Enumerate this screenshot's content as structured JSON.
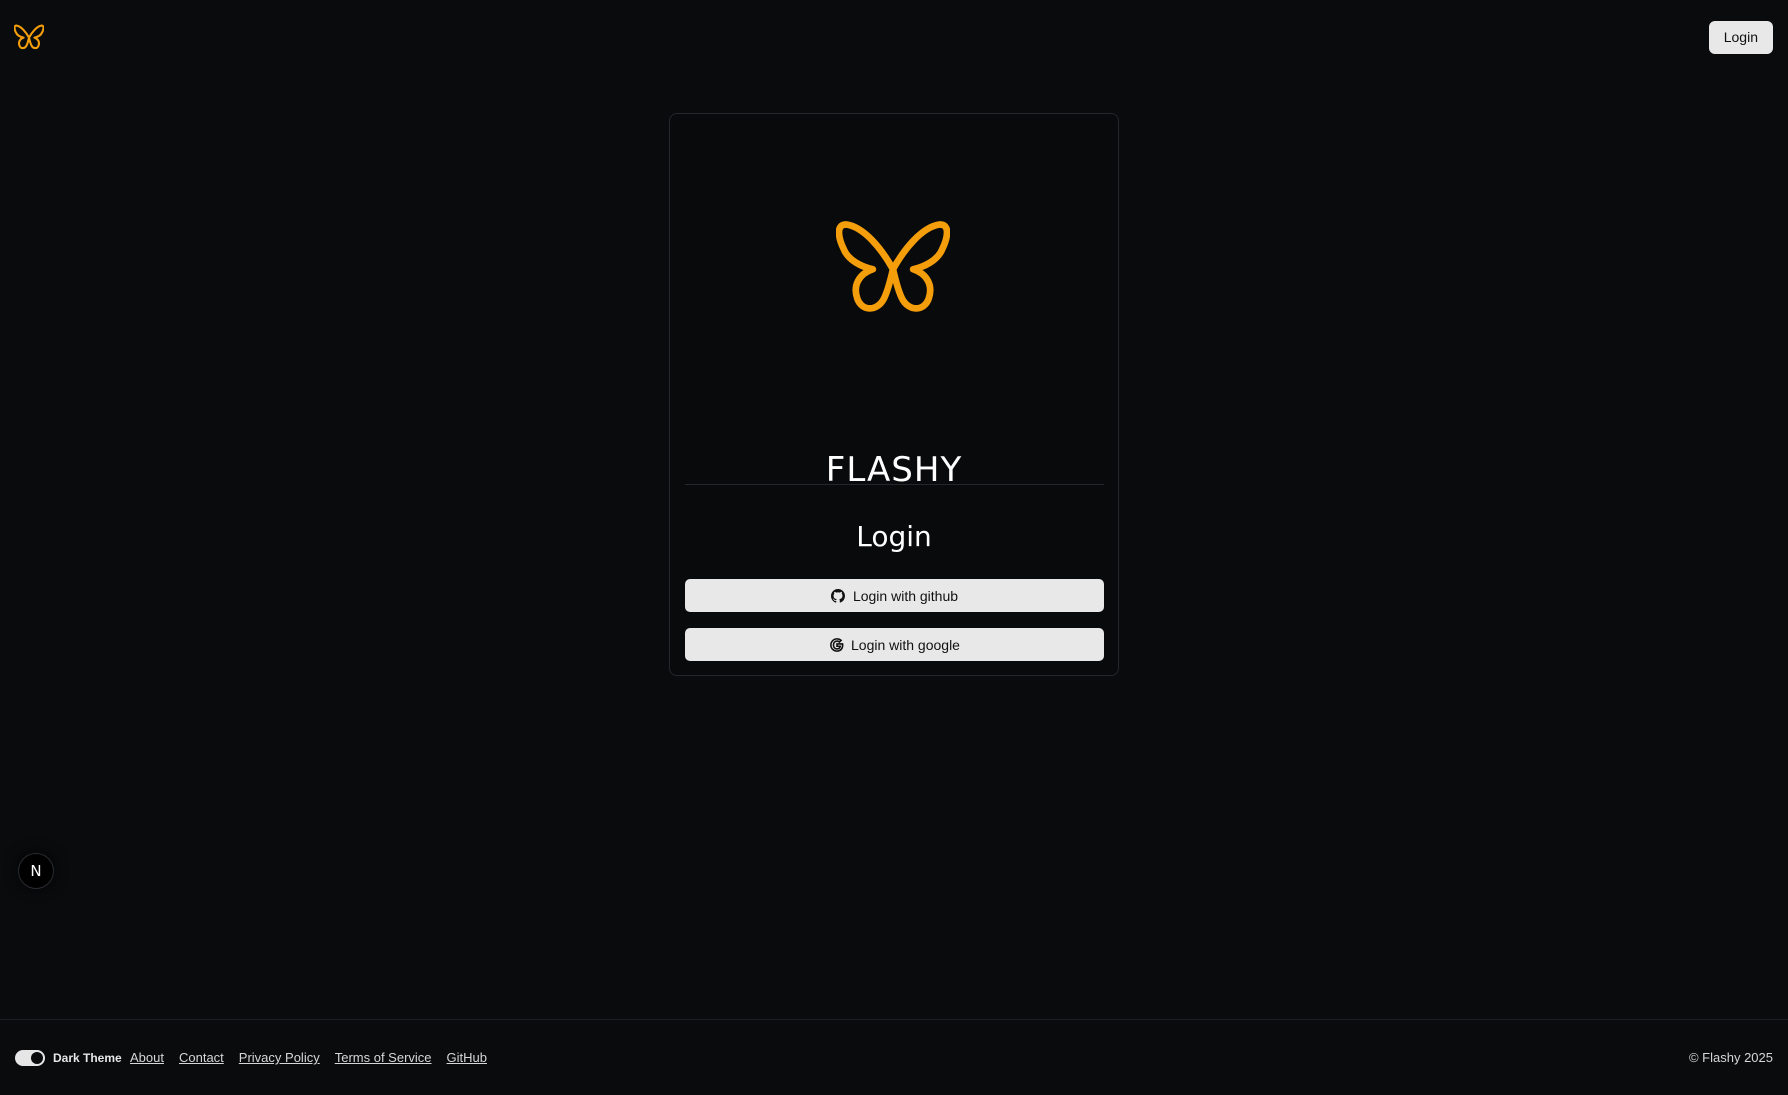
{
  "header": {
    "logo_icon": "butterfly-icon",
    "login_label": "Login"
  },
  "card": {
    "hero_icon": "butterfly-icon",
    "brand_name": "FLASHY",
    "title": "Login",
    "buttons": [
      {
        "icon": "github-icon",
        "label": "Login with github"
      },
      {
        "icon": "google-icon",
        "label": "Login with google"
      }
    ]
  },
  "badge": {
    "label": "N"
  },
  "footer": {
    "theme_label": "Dark Theme",
    "theme_enabled": true,
    "links": [
      "About",
      "Contact",
      "Privacy Policy",
      "Terms of Service",
      "GitHub"
    ],
    "copyright": "© Flashy 2025"
  },
  "colors": {
    "background": "#0a0b0d",
    "accent": "#f59e0b",
    "button_bg": "#e8e8e9",
    "border": "#24262b"
  }
}
